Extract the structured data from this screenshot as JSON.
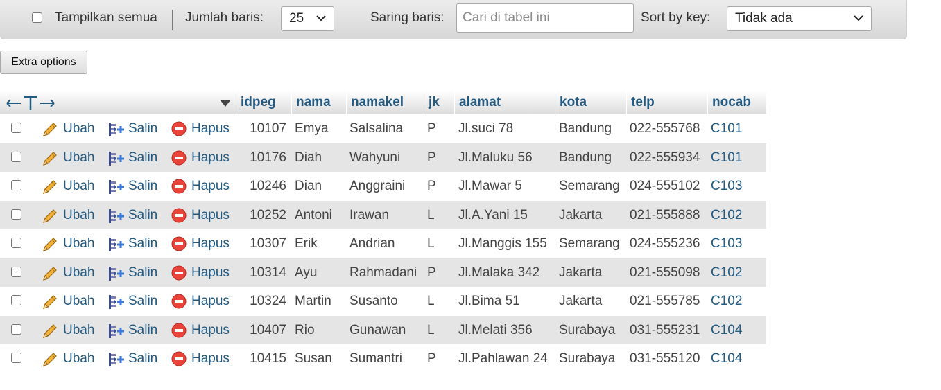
{
  "toolbar": {
    "show_all_label": "Tampilkan semua",
    "rows_label": "Jumlah baris:",
    "rows_value": "25",
    "filter_label": "Saring baris:",
    "filter_placeholder": "Cari di tabel ini",
    "sort_label": "Sort by key:",
    "sort_value": "Tidak ada"
  },
  "extra_options_label": "Extra options",
  "table": {
    "columns": [
      "idpeg",
      "nama",
      "namakel",
      "jk",
      "alamat",
      "kota",
      "telp",
      "nocab"
    ],
    "actions": {
      "edit": "Ubah",
      "copy": "Salin",
      "delete": "Hapus"
    },
    "rows": [
      [
        "10107",
        "Emya",
        "Salsalina",
        "P",
        "Jl.suci 78",
        "Bandung",
        "022-555768",
        "C101"
      ],
      [
        "10176",
        "Diah",
        "Wahyuni",
        "P",
        "Jl.Maluku 56",
        "Bandung",
        "022-555934",
        "C101"
      ],
      [
        "10246",
        "Dian",
        "Anggraini",
        "P",
        "Jl.Mawar 5",
        "Semarang",
        "024-555102",
        "C103"
      ],
      [
        "10252",
        "Antoni",
        "Irawan",
        "L",
        "Jl.A.Yani 15",
        "Jakarta",
        "021-555888",
        "C102"
      ],
      [
        "10307",
        "Erik",
        "Andrian",
        "L",
        "Jl.Manggis 155",
        "Semarang",
        "024-555236",
        "C103"
      ],
      [
        "10314",
        "Ayu",
        "Rahmadani",
        "P",
        "Jl.Malaka 342",
        "Jakarta",
        "021-555098",
        "C102"
      ],
      [
        "10324",
        "Martin",
        "Susanto",
        "L",
        "Jl.Bima 51",
        "Jakarta",
        "021-555785",
        "C102"
      ],
      [
        "10407",
        "Rio",
        "Gunawan",
        "L",
        "Jl.Melati 356",
        "Surabaya",
        "031-555231",
        "C104"
      ],
      [
        "10415",
        "Susan",
        "Sumantri",
        "P",
        "Jl.Pahlawan 24",
        "Surabaya",
        "031-555120",
        "C104"
      ]
    ]
  },
  "colors": {
    "link": "#235a81",
    "row_alt": "#e5e5e5",
    "delete_icon": "#e8443a"
  },
  "icons": {
    "edit": "pencil-icon",
    "copy": "insert-row-icon",
    "delete": "delete-circle-icon",
    "column_arrows": "column-arrows-icon",
    "sort_dropdown": "triangle-down-icon"
  }
}
